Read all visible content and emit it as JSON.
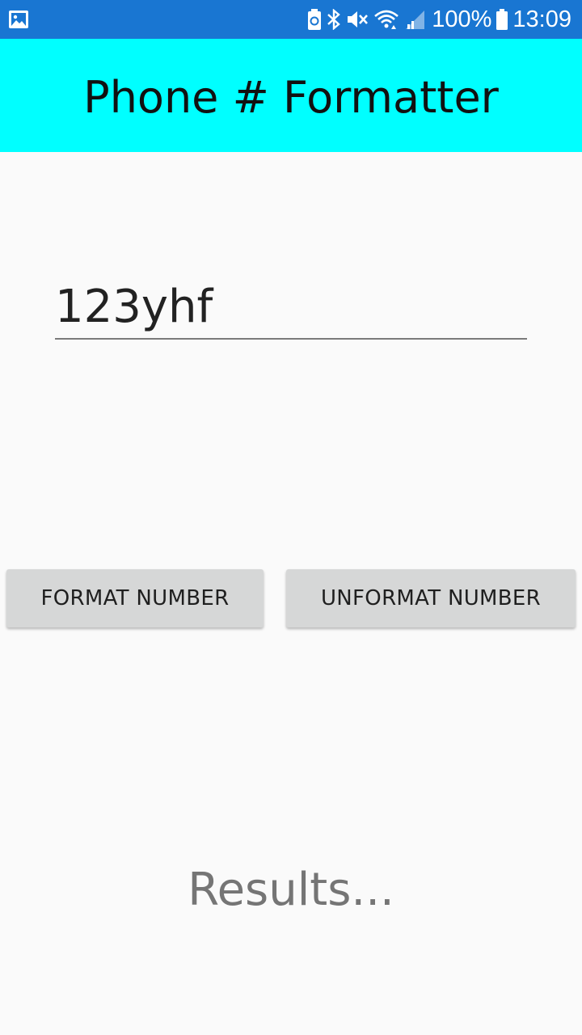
{
  "status_bar": {
    "left_icon": "gallery-notification-icon",
    "right_icons": [
      "battery-saver-icon",
      "bluetooth-icon",
      "mute-icon",
      "wifi-icon",
      "signal-icon",
      "battery-icon"
    ],
    "battery_percent": "100%",
    "time": "13:09",
    "background_color": "#1976d2"
  },
  "app_bar": {
    "title": "Phone # Formatter",
    "background_color": "#00ffff"
  },
  "input": {
    "value": "123yhf"
  },
  "buttons": {
    "format_label": "FORMAT NUMBER",
    "unformat_label": "UNFORMAT NUMBER"
  },
  "results": {
    "text": "Results..."
  }
}
